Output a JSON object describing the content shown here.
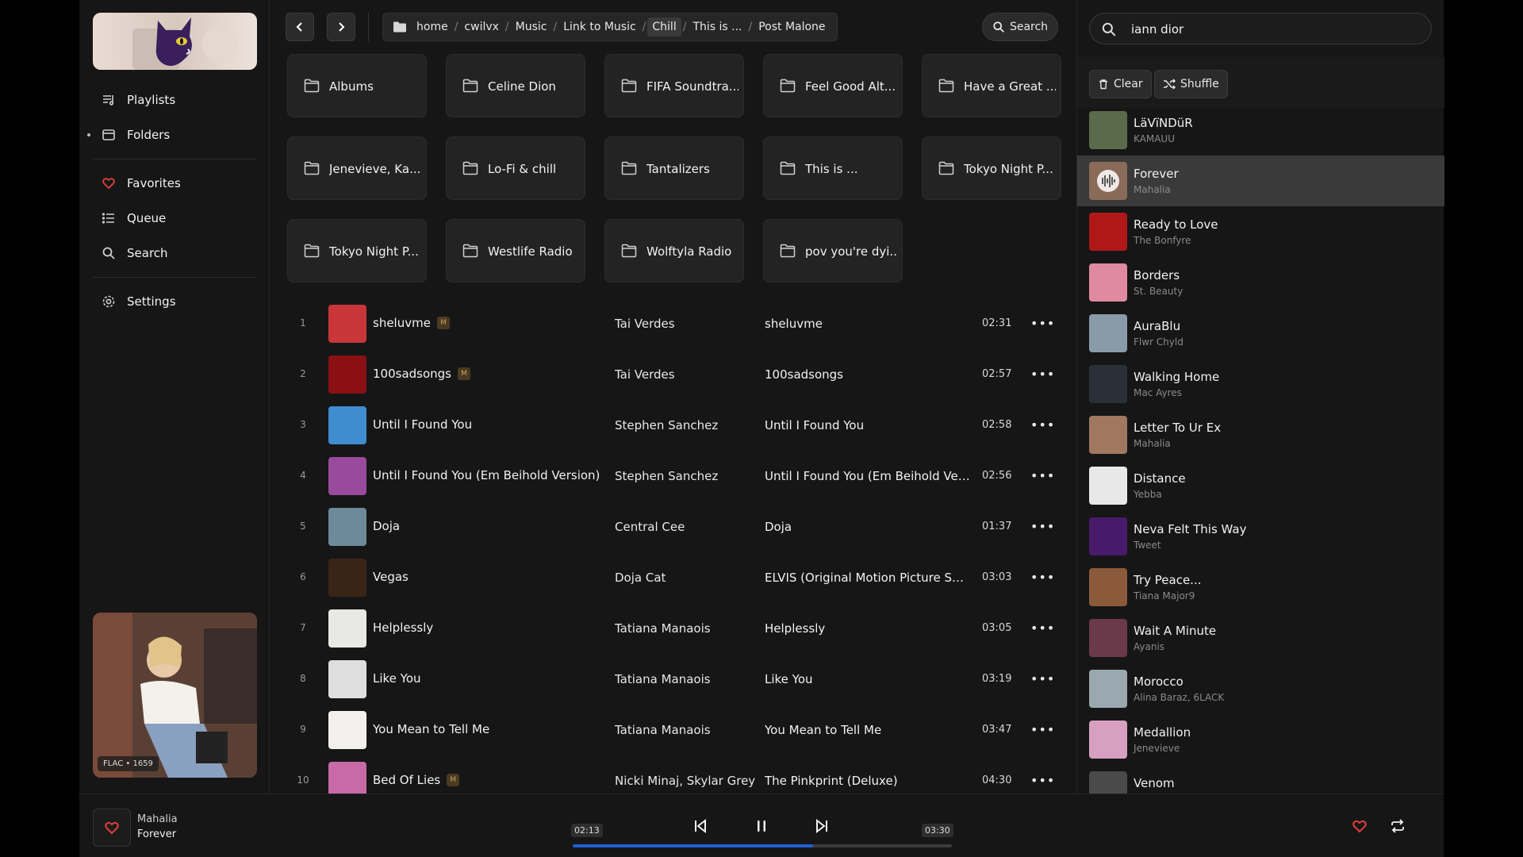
{
  "colors": {
    "accent": "#1f5fd6",
    "heart": "#e0403a",
    "background": "#161616"
  },
  "sidebar": {
    "items": [
      {
        "label": "Playlists",
        "icon": "playlist-icon"
      },
      {
        "label": "Folders",
        "icon": "folder-icon",
        "active": true
      },
      {
        "label": "Favorites",
        "icon": "heart-icon"
      },
      {
        "label": "Queue",
        "icon": "queue-icon"
      },
      {
        "label": "Search",
        "icon": "search-icon"
      },
      {
        "label": "Settings",
        "icon": "gear-icon"
      }
    ],
    "cover_badge": "FLAC • 1659"
  },
  "breadcrumb": [
    "home",
    "cwilvx",
    "Music",
    "Link to Music",
    "Chill",
    "This is ...",
    "Post Malone"
  ],
  "breadcrumb_active": "Chill",
  "topbar": {
    "search_label": "Search"
  },
  "folders": [
    "Albums",
    "Celine Dion",
    "FIFA Soundtra...",
    "Feel Good Alt...",
    "Have a Great ...",
    "Jenevieve, Ka...",
    "Lo-Fi & chill",
    "Tantalizers",
    "This is ...",
    "Tokyo Night P...",
    "Tokyo Night P...",
    "Westlife Radio",
    "Wolftyla Radio",
    "pov you're dyi..."
  ],
  "tracks": [
    {
      "num": "1",
      "title": "sheluvme",
      "explicit": true,
      "artist": "Tai Verdes",
      "album": "sheluvme",
      "duration": "02:31",
      "color": "#c8363a"
    },
    {
      "num": "2",
      "title": "100sadsongs",
      "explicit": true,
      "artist": "Tai Verdes",
      "album": "100sadsongs",
      "duration": "02:57",
      "color": "#8a1014"
    },
    {
      "num": "3",
      "title": "Until I Found You",
      "explicit": false,
      "artist": "Stephen Sanchez",
      "album": "Until I Found You",
      "duration": "02:58",
      "color": "#3f8ccf"
    },
    {
      "num": "4",
      "title": "Until I Found You (Em Beihold Version)",
      "explicit": false,
      "artist": "Stephen Sanchez",
      "album": "Until I Found You (Em Beihold Versio...",
      "duration": "02:56",
      "color": "#9a4a9c"
    },
    {
      "num": "5",
      "title": "Doja",
      "explicit": false,
      "artist": "Central Cee",
      "album": "Doja",
      "duration": "01:37",
      "color": "#6d8a9a"
    },
    {
      "num": "6",
      "title": "Vegas",
      "explicit": false,
      "artist": "Doja Cat",
      "album": "ELVIS (Original Motion Picture Soun...",
      "duration": "03:03",
      "color": "#3a2418"
    },
    {
      "num": "7",
      "title": "Helplessly",
      "explicit": false,
      "artist": "Tatiana Manaois",
      "album": "Helplessly",
      "duration": "03:05",
      "color": "#e8e8e4"
    },
    {
      "num": "8",
      "title": "Like You",
      "explicit": false,
      "artist": "Tatiana Manaois",
      "album": "Like You",
      "duration": "03:19",
      "color": "#dedede"
    },
    {
      "num": "9",
      "title": "You Mean to Tell Me",
      "explicit": false,
      "artist": "Tatiana Manaois",
      "album": "You Mean to Tell Me",
      "duration": "03:47",
      "color": "#f2f0ec"
    },
    {
      "num": "10",
      "title": "Bed Of Lies",
      "explicit": true,
      "artist": "Nicki Minaj, Skylar Grey",
      "album": "The Pinkprint (Deluxe)",
      "duration": "04:30",
      "color": "#c86aa8"
    }
  ],
  "queue": {
    "search_value": "iann dior",
    "clear_label": "Clear",
    "shuffle_label": "Shuffle",
    "items": [
      {
        "title": "LäVïNDüR",
        "artist": "KAMAUU",
        "color": "#5a6a4a"
      },
      {
        "title": "Forever",
        "artist": "Mahalia",
        "color": "#8a6a58",
        "active": true
      },
      {
        "title": "Ready to Love",
        "artist": "The Bonfyre",
        "color": "#b01818"
      },
      {
        "title": "Borders",
        "artist": "St. Beauty",
        "color": "#e08aa0"
      },
      {
        "title": "AuraBlu",
        "artist": "Flwr Chyld",
        "color": "#8a9aa8"
      },
      {
        "title": "Walking Home",
        "artist": "Mac Ayres",
        "color": "#2a3038"
      },
      {
        "title": "Letter To Ur Ex",
        "artist": "Mahalia",
        "color": "#a07860"
      },
      {
        "title": "Distance",
        "artist": "Yebba",
        "color": "#e8e8e8"
      },
      {
        "title": "Neva Felt This Way",
        "artist": "Tweet",
        "color": "#4a1a6a"
      },
      {
        "title": "Try Peace...",
        "artist": "Tiana Major9",
        "color": "#8a5a3a"
      },
      {
        "title": "Wait A Minute",
        "artist": "Ayanis",
        "color": "#6a3a4a"
      },
      {
        "title": "Morocco",
        "artist": "Alina Baraz, 6LACK",
        "color": "#9aa8b0"
      },
      {
        "title": "Medallion",
        "artist": "Jenevieve",
        "color": "#d8a0c0"
      },
      {
        "title": "Venom",
        "artist": "",
        "color": "#4a4a4a"
      }
    ]
  },
  "player": {
    "artist": "Mahalia",
    "title": "Forever",
    "elapsed": "02:13",
    "total": "03:30",
    "progress": 0.634
  }
}
